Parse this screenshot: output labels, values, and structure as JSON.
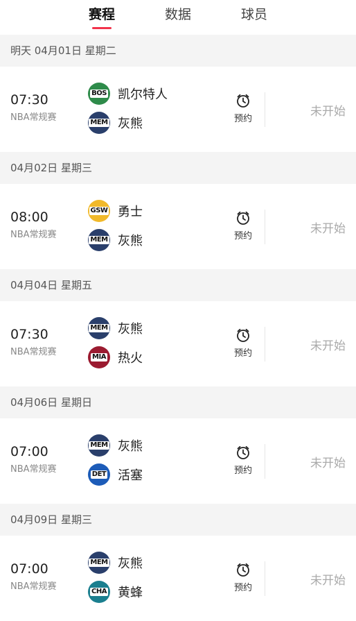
{
  "tabs": [
    {
      "label": "赛程",
      "active": true
    },
    {
      "label": "数据",
      "active": false
    },
    {
      "label": "球员",
      "active": false
    }
  ],
  "colors": {
    "accent": "#f2334b"
  },
  "days": [
    {
      "header": "明天 04月01日 星期二",
      "games": [
        {
          "time": "07:30",
          "league": "NBA常规赛",
          "team1": {
            "abbr": "BOS",
            "name": "凯尔特人",
            "logo_color": "#2e8b4a"
          },
          "team2": {
            "abbr": "MEM",
            "name": "灰熊",
            "logo_color": "#2a3f6b"
          },
          "remind_label": "预约",
          "status": "未开始"
        }
      ]
    },
    {
      "header": "04月02日 星期三",
      "games": [
        {
          "time": "08:00",
          "league": "NBA常规赛",
          "team1": {
            "abbr": "GSW",
            "name": "勇士",
            "logo_color": "#f1b92a"
          },
          "team2": {
            "abbr": "MEM",
            "name": "灰熊",
            "logo_color": "#2a3f6b"
          },
          "remind_label": "预约",
          "status": "未开始"
        }
      ]
    },
    {
      "header": "04月04日 星期五",
      "games": [
        {
          "time": "07:30",
          "league": "NBA常规赛",
          "team1": {
            "abbr": "MEM",
            "name": "灰熊",
            "logo_color": "#2a3f6b"
          },
          "team2": {
            "abbr": "MIA",
            "name": "热火",
            "logo_color": "#9b1b30"
          },
          "remind_label": "预约",
          "status": "未开始"
        }
      ]
    },
    {
      "header": "04月06日 星期日",
      "games": [
        {
          "time": "07:00",
          "league": "NBA常规赛",
          "team1": {
            "abbr": "MEM",
            "name": "灰熊",
            "logo_color": "#2a3f6b"
          },
          "team2": {
            "abbr": "DET",
            "name": "活塞",
            "logo_color": "#1d5cb8"
          },
          "remind_label": "预约",
          "status": "未开始"
        }
      ]
    },
    {
      "header": "04月09日 星期三",
      "games": [
        {
          "time": "07:00",
          "league": "NBA常规赛",
          "team1": {
            "abbr": "MEM",
            "name": "灰熊",
            "logo_color": "#2a3f6b"
          },
          "team2": {
            "abbr": "CHA",
            "name": "黄蜂",
            "logo_color": "#1b7f8f"
          },
          "remind_label": "预约",
          "status": "未开始"
        }
      ]
    }
  ]
}
